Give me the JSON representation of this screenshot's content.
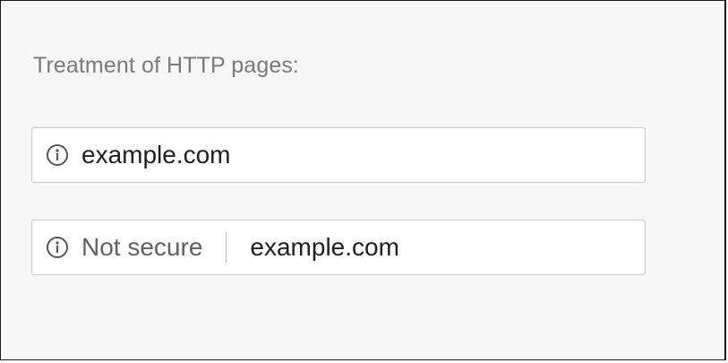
{
  "section": {
    "heading": "Treatment of HTTP pages:"
  },
  "omnibox_current": {
    "icon": "info-icon",
    "url": "example.com"
  },
  "omnibox_new": {
    "icon": "info-icon",
    "security_label": "Not secure",
    "url": "example.com"
  }
}
